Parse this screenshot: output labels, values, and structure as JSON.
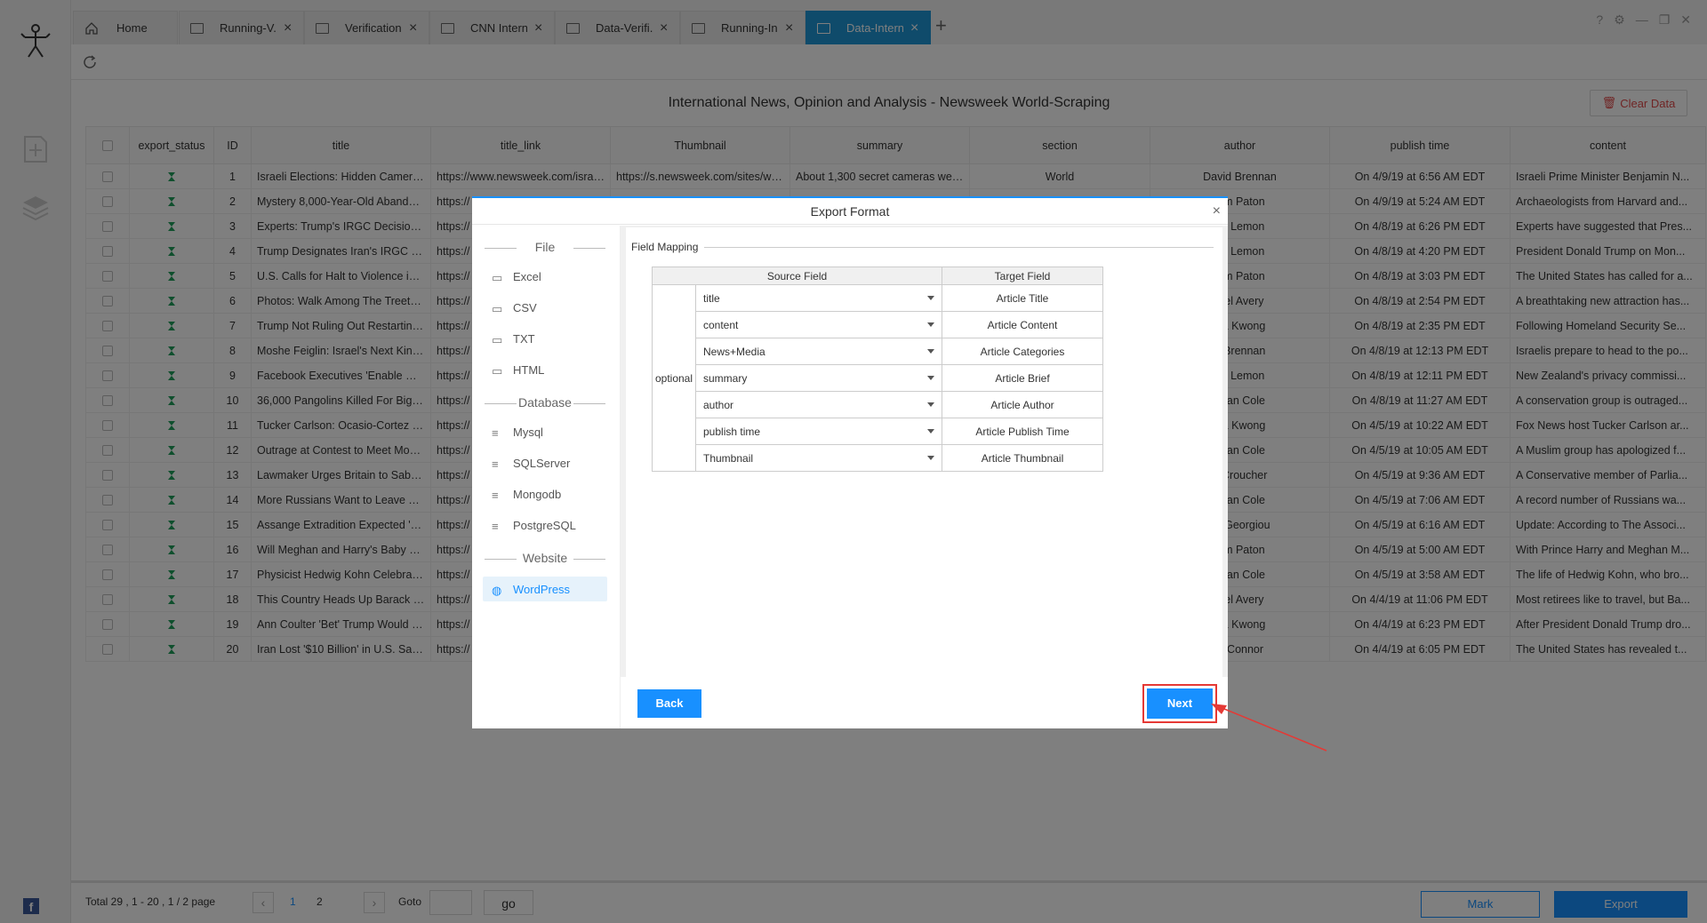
{
  "tabs": [
    {
      "label": "Home"
    },
    {
      "label": "Running-V..."
    },
    {
      "label": "Verification..."
    },
    {
      "label": "CNN Intern..."
    },
    {
      "label": "Data-Verifi..."
    },
    {
      "label": "Running-In..."
    },
    {
      "label": "Data-Intern..."
    }
  ],
  "active_tab_index": 6,
  "page_title": "International News, Opinion and Analysis - Newsweek World-Scraping",
  "clear_data_label": "Clear Data",
  "table": {
    "columns": [
      "export_status",
      "ID",
      "title",
      "title_link",
      "Thumbnail",
      "summary",
      "section",
      "author",
      "publish time",
      "content"
    ],
    "rows": [
      {
        "id": "1",
        "title": "Israeli Elections: Hidden Camera...",
        "link": "https://www.newsweek.com/israe...",
        "thumb": "https://s.newsweek.com/sites/ww...",
        "summary": "About 1,300 secret cameras were...",
        "section": "World",
        "author": "David Brennan",
        "time": "On 4/9/19 at 6:56 AM EDT",
        "content": "Israeli Prime Minister Benjamin N..."
      },
      {
        "id": "2",
        "title": "Mystery 8,000-Year-Old Abandon...",
        "link": "https://",
        "author": "lum Paton",
        "time": "On 4/9/19 at 5:24 AM EDT",
        "content": "Archaeologists from Harvard and..."
      },
      {
        "id": "3",
        "title": "Experts: Trump's IRGC Decision ...",
        "link": "https://",
        "author": "on Lemon",
        "time": "On 4/8/19 at 6:26 PM EDT",
        "content": "Experts have suggested that Pres..."
      },
      {
        "id": "4",
        "title": "Trump Designates Iran's IRGC as...",
        "link": "https://",
        "author": "on Lemon",
        "time": "On 4/8/19 at 4:20 PM EDT",
        "content": "President Donald Trump on Mon..."
      },
      {
        "id": "5",
        "title": "U.S. Calls for Halt to Violence in ...",
        "link": "https://",
        "author": "lum Paton",
        "time": "On 4/8/19 at 3:03 PM EDT",
        "content": "The United States has called for a..."
      },
      {
        "id": "6",
        "title": "Photos: Walk Among The Treetop...",
        "link": "https://",
        "author": "niel Avery",
        "time": "On 4/8/19 at 2:54 PM EDT",
        "content": "A breathtaking new attraction has..."
      },
      {
        "id": "7",
        "title": "Trump Not Ruling Out Restarting ...",
        "link": "https://",
        "author": "ica Kwong",
        "time": "On 4/8/19 at 2:35 PM EDT",
        "content": "Following Homeland Security Se..."
      },
      {
        "id": "8",
        "title": "Moshe Feiglin: Israel's Next King...",
        "link": "https://",
        "author": "d Brennan",
        "time": "On 4/8/19 at 12:13 PM EDT",
        "content": "Israelis prepare to head to the po..."
      },
      {
        "id": "9",
        "title": "Facebook Executives 'Enable Ge...",
        "link": "https://",
        "author": "on Lemon",
        "time": "On 4/8/19 at 12:11 PM EDT",
        "content": "New Zealand's privacy commissi..."
      },
      {
        "id": "10",
        "title": "36,000 Pangolins Killed For Bigg...",
        "link": "https://",
        "author": "ndan Cole",
        "time": "On 4/8/19 at 11:27 AM EDT",
        "content": "A conservation group is outraged..."
      },
      {
        "id": "11",
        "title": "Tucker Carlson: Ocasio-Cortez \"m...",
        "link": "https://",
        "author": "ica Kwong",
        "time": "On 4/5/19 at 10:22 AM EDT",
        "content": "Fox News host Tucker Carlson ar..."
      },
      {
        "id": "12",
        "title": "Outrage at Contest to Meet Mosq...",
        "link": "https://",
        "author": "ndan Cole",
        "time": "On 4/5/19 at 10:05 AM EDT",
        "content": "A Muslim group has apologized f..."
      },
      {
        "id": "13",
        "title": "Lawmaker Urges Britain to Sabot...",
        "link": "https://",
        "author": "e Croucher",
        "time": "On 4/5/19 at 9:36 AM EDT",
        "content": "A Conservative member of Parlia..."
      },
      {
        "id": "14",
        "title": "More Russians Want to Leave Th...",
        "link": "https://",
        "author": "ndan Cole",
        "time": "On 4/5/19 at 7:06 AM EDT",
        "content": "A record number of Russians wa..."
      },
      {
        "id": "15",
        "title": "Assange Extradition Expected 'W...",
        "link": "https://",
        "author": "es Georgiou",
        "time": "On 4/5/19 at 6:16 AM EDT",
        "content": "Update: According to The Associ..."
      },
      {
        "id": "16",
        "title": "Will Meghan and Harry's Baby H...",
        "link": "https://",
        "author": "lum Paton",
        "time": "On 4/5/19 at 5:00 AM EDT",
        "content": "With Prince Harry and Meghan M..."
      },
      {
        "id": "17",
        "title": "Physicist Hedwig Kohn Celebrate...",
        "link": "https://",
        "author": "ndan Cole",
        "time": "On 4/5/19 at 3:58 AM EDT",
        "content": "The life of Hedwig Kohn, who bro..."
      },
      {
        "id": "18",
        "title": "This Country Heads Up Barack O...",
        "link": "https://",
        "author": "niel Avery",
        "time": "On 4/4/19 at 11:06 PM EDT",
        "content": "Most retirees like to travel, but Ba..."
      },
      {
        "id": "19",
        "title": "Ann Coulter 'Bet' Trump Would N...",
        "link": "https://",
        "author": "ica Kwong",
        "time": "On 4/4/19 at 6:23 PM EDT",
        "content": "After President Donald Trump dro..."
      },
      {
        "id": "20",
        "title": "Iran Lost '$10 Billion' in U.S. San...",
        "link": "https://",
        "author": "O'Connor",
        "time": "On 4/4/19 at 6:05 PM EDT",
        "content": "The United States has revealed t..."
      }
    ]
  },
  "pager": {
    "info": "Total  29 ,  1 - 20 ,  1 / 2  page",
    "page1": "1",
    "page2": "2",
    "goto_label": "Goto",
    "go_label": "go",
    "mark_label": "Mark",
    "export_label": "Export"
  },
  "modal": {
    "title": "Export Format",
    "close": "×",
    "sections": {
      "file": "File",
      "database": "Database",
      "website": "Website"
    },
    "file_items": [
      "Excel",
      "CSV",
      "TXT",
      "HTML"
    ],
    "db_items": [
      "Mysql",
      "SQLServer",
      "Mongodb",
      "PostgreSQL"
    ],
    "web_items": [
      "WordPress"
    ],
    "field_mapping_title": "Field Mapping",
    "source_header": "Source Field",
    "target_header": "Target Field",
    "optional_label": "optional",
    "mappings": [
      {
        "source": "title",
        "target": "Article Title"
      },
      {
        "source": "content",
        "target": "Article Content"
      },
      {
        "source": "News+Media",
        "target": "Article Categories"
      },
      {
        "source": "summary",
        "target": "Article Brief"
      },
      {
        "source": "author",
        "target": "Article Author"
      },
      {
        "source": "publish time",
        "target": "Article Publish Time"
      },
      {
        "source": "Thumbnail",
        "target": "Article Thumbnail"
      }
    ],
    "back_label": "Back",
    "next_label": "Next"
  },
  "colors": {
    "accent": "#1890ff",
    "active_tab": "#1f97d6",
    "highlight": "#e53935",
    "status_icon": "#1e9e5a"
  }
}
